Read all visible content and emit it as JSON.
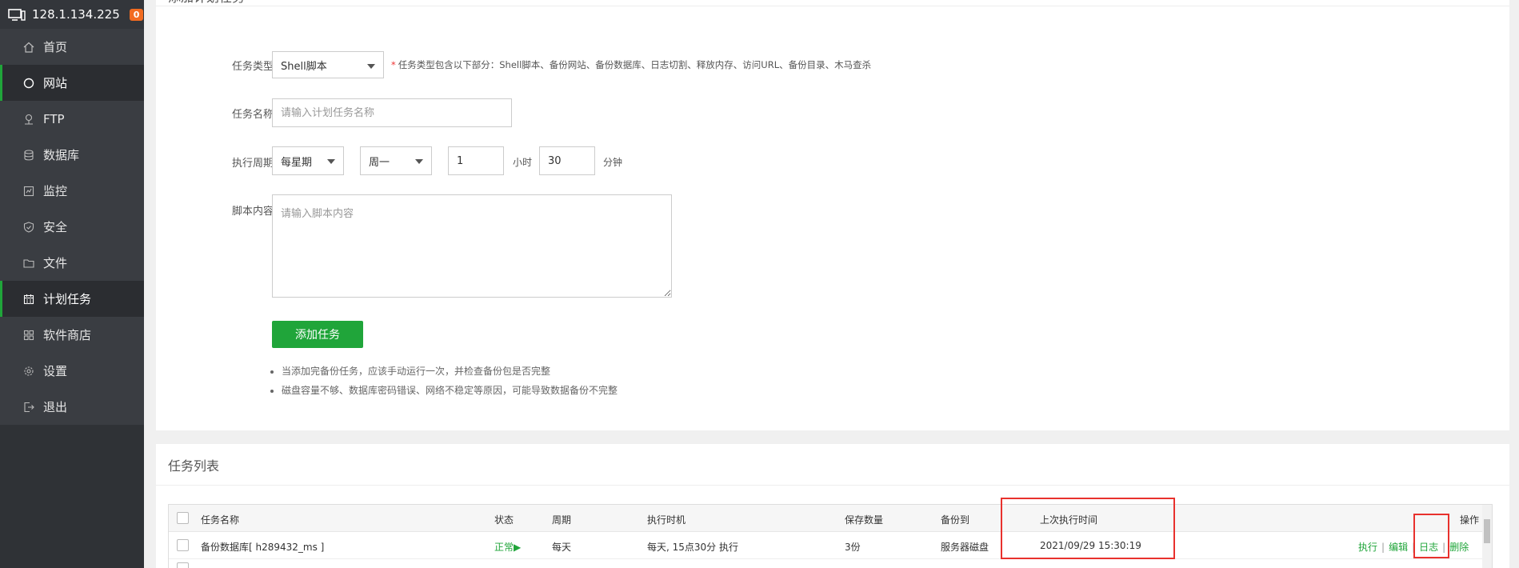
{
  "server": {
    "ip": "128.1.134.225",
    "badge": "0"
  },
  "sidebar": {
    "items": [
      {
        "label": "首页",
        "icon": "home-icon",
        "active": false
      },
      {
        "label": "网站",
        "icon": "globe-icon",
        "active": true
      },
      {
        "label": "FTP",
        "icon": "ftp-icon",
        "active": false
      },
      {
        "label": "数据库",
        "icon": "database-icon",
        "active": false
      },
      {
        "label": "监控",
        "icon": "monitor-icon",
        "active": false
      },
      {
        "label": "安全",
        "icon": "shield-icon",
        "active": false
      },
      {
        "label": "文件",
        "icon": "folder-icon",
        "active": false
      },
      {
        "label": "计划任务",
        "icon": "calendar-icon",
        "active": true
      },
      {
        "label": "软件商店",
        "icon": "apps-icon",
        "active": false
      },
      {
        "label": "设置",
        "icon": "gear-icon",
        "active": false
      },
      {
        "label": "退出",
        "icon": "logout-icon",
        "active": false
      }
    ]
  },
  "add_task": {
    "title": "添加计划任务",
    "task_type_label": "任务类型",
    "task_type_value": "Shell脚本",
    "task_type_hint": "任务类型包含以下部分：Shell脚本、备份网站、备份数据库、日志切割、释放内存、访问URL、备份目录、木马查杀",
    "task_name_label": "任务名称",
    "task_name_placeholder": "请输入计划任务名称",
    "period_label": "执行周期",
    "period_value": "每星期",
    "weekday_value": "周一",
    "hour_value": "1",
    "hour_unit": "小时",
    "minute_value": "30",
    "minute_unit": "分钟",
    "script_label": "脚本内容",
    "script_placeholder": "请输入脚本内容",
    "submit_label": "添加任务",
    "notes": [
      "当添加完备份任务，应该手动运行一次，并检查备份包是否完整",
      "磁盘容量不够、数据库密码错误、网络不稳定等原因，可能导致数据备份不完整"
    ]
  },
  "task_list": {
    "title": "任务列表",
    "columns": [
      "任务名称",
      "状态",
      "周期",
      "执行时机",
      "保存数量",
      "备份到",
      "上次执行时间",
      "操作"
    ],
    "rows": [
      {
        "name": "备份数据库[ h289432_ms ]",
        "status": "正常▶",
        "period": "每天",
        "timing": "每天, 15点30分 执行",
        "keep": "3份",
        "backup_to": "服务器磁盘",
        "last_run": "2021/09/29 15:30:19",
        "ops": [
          "执行",
          "编辑",
          "日志",
          "删除"
        ]
      }
    ]
  },
  "colors": {
    "accent": "#20a53a",
    "highlight": "#e8312d",
    "sidebar": "#2f3236"
  }
}
